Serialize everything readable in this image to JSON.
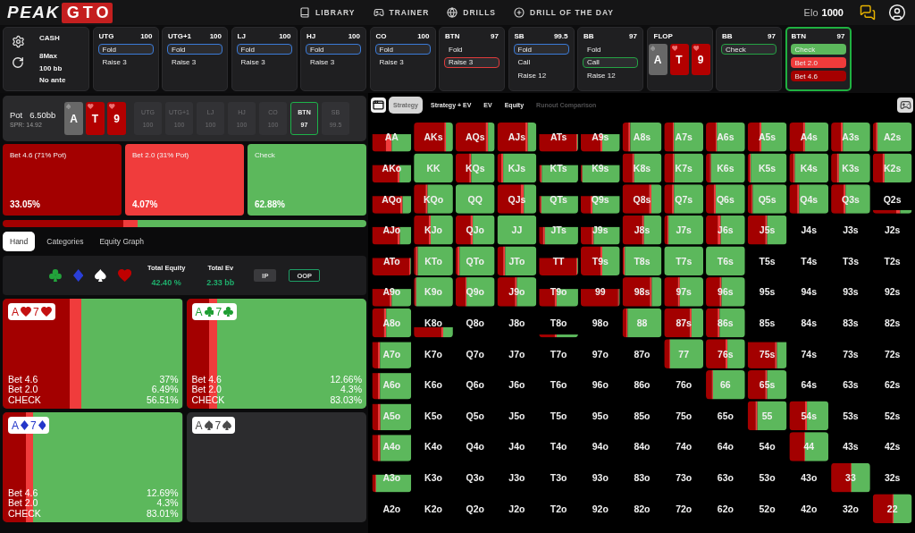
{
  "nav": {
    "logo": {
      "word": "PEAK",
      "emblem": "GTO"
    },
    "links": [
      {
        "label": "LIBRARY"
      },
      {
        "label": "TRAINER"
      },
      {
        "label": "DRILLS"
      },
      {
        "label": "DRILL OF THE DAY"
      }
    ],
    "elo": {
      "label": "Elo",
      "value": "1000"
    }
  },
  "action_history": [
    {
      "kind": "settings",
      "lines": [
        "CASH",
        "8Max",
        "100 bb",
        "No ante"
      ]
    },
    {
      "kind": "player",
      "position": "UTG",
      "stack": "100",
      "active": false,
      "options": [
        {
          "label": "Fold",
          "selected": true,
          "color": "#3b7bd8"
        },
        {
          "label": "Raise 3",
          "selected": false
        }
      ]
    },
    {
      "kind": "player",
      "position": "UTG+1",
      "stack": "100",
      "active": false,
      "options": [
        {
          "label": "Fold",
          "selected": true,
          "color": "#3b7bd8"
        },
        {
          "label": "Raise 3",
          "selected": false
        }
      ]
    },
    {
      "kind": "player",
      "position": "LJ",
      "stack": "100",
      "active": false,
      "options": [
        {
          "label": "Fold",
          "selected": true,
          "color": "#3b7bd8"
        },
        {
          "label": "Raise 3",
          "selected": false
        }
      ]
    },
    {
      "kind": "player",
      "position": "HJ",
      "stack": "100",
      "active": false,
      "options": [
        {
          "label": "Fold",
          "selected": true,
          "color": "#3b7bd8"
        },
        {
          "label": "Raise 3",
          "selected": false
        }
      ]
    },
    {
      "kind": "player",
      "position": "CO",
      "stack": "100",
      "active": false,
      "options": [
        {
          "label": "Fold",
          "selected": true,
          "color": "#3b7bd8"
        },
        {
          "label": "Raise 3",
          "selected": false
        }
      ]
    },
    {
      "kind": "player",
      "position": "BTN",
      "stack": "97",
      "active": false,
      "options": [
        {
          "label": "Fold",
          "selected": false
        },
        {
          "label": "Raise 3",
          "selected": true,
          "color": "#e03b3b"
        }
      ]
    },
    {
      "kind": "player",
      "position": "SB",
      "stack": "99.5",
      "active": false,
      "options": [
        {
          "label": "Fold",
          "selected": true,
          "color": "#3b7bd8"
        },
        {
          "label": "Call",
          "selected": false
        },
        {
          "label": "Raise 12",
          "selected": false
        }
      ]
    },
    {
      "kind": "player",
      "position": "BB",
      "stack": "97",
      "active": false,
      "options": [
        {
          "label": "Fold",
          "selected": false
        },
        {
          "label": "Call",
          "selected": true,
          "color": "#25a244"
        },
        {
          "label": "Raise 12",
          "selected": false
        }
      ]
    },
    {
      "kind": "board",
      "street": "FLOP",
      "cards": [
        {
          "rank": "A",
          "kind": "spade"
        },
        {
          "rank": "T",
          "kind": "heart"
        },
        {
          "rank": "9",
          "kind": "heart"
        }
      ]
    },
    {
      "kind": "player",
      "position": "BB",
      "stack": "97",
      "active": false,
      "options": [
        {
          "label": "Check",
          "selected": true,
          "color": "#25a244"
        }
      ]
    },
    {
      "kind": "player",
      "position": "BTN",
      "stack": "97",
      "active": true,
      "options": [
        {
          "label": "Check",
          "selected": false,
          "color": "#5cb85c"
        },
        {
          "label": "Bet 2.0",
          "selected": false,
          "color": "#ef3b3b"
        },
        {
          "label": "Bet 4.6",
          "selected": false,
          "color": "#a50000"
        }
      ]
    }
  ],
  "pot": {
    "label": "Pot",
    "value": "6.50bb",
    "spr": "SPR: 14.92",
    "board": [
      {
        "rank": "A",
        "kind": "spade"
      },
      {
        "rank": "T",
        "kind": "heart"
      },
      {
        "rank": "9",
        "kind": "heart"
      }
    ],
    "seats": [
      {
        "position": "UTG",
        "stack": "100",
        "selected": false
      },
      {
        "position": "UTG+1",
        "stack": "100",
        "selected": false
      },
      {
        "position": "LJ",
        "stack": "100",
        "selected": false
      },
      {
        "position": "HJ",
        "stack": "100",
        "selected": false
      },
      {
        "position": "CO",
        "stack": "100",
        "selected": false
      },
      {
        "position": "BTN",
        "stack": "97",
        "selected": true
      },
      {
        "position": "SB",
        "stack": "99.5",
        "selected": false
      }
    ]
  },
  "strategy": {
    "actions": [
      {
        "label": "Bet 4.6 (71% Pot)",
        "share": "33.05%",
        "color": "#a30000"
      },
      {
        "label": "Bet 2.0 (31% Pot)",
        "share": "4.07%",
        "color": "#f03c3c"
      },
      {
        "label": "Check",
        "share": "62.88%",
        "color": "#5cb85c"
      }
    ]
  },
  "hand_tabs": [
    {
      "label": "Hand",
      "selected": true
    },
    {
      "label": "Categories",
      "selected": false
    },
    {
      "label": "Equity Graph",
      "selected": false
    }
  ],
  "hand_panel": {
    "suit_filters": [
      {
        "kind": "club"
      },
      {
        "kind": "diamond"
      },
      {
        "kind": "spade"
      },
      {
        "kind": "heart"
      }
    ],
    "stats": [
      {
        "label": "Total Equity",
        "value": "42.40 %"
      },
      {
        "label": "Total Ev",
        "value": "2.33 bb"
      }
    ],
    "sides": [
      {
        "label": "IP",
        "selected": false
      },
      {
        "label": "OOP",
        "selected": true
      }
    ]
  },
  "combos": [
    {
      "cards": [
        {
          "rank": "A",
          "kind": "heart"
        },
        {
          "rank": "7",
          "kind": "heart"
        }
      ],
      "rows": [
        {
          "label": "Bet 4.6",
          "value": "37%"
        },
        {
          "label": "Bet 2.0",
          "value": "6.49%"
        },
        {
          "label": "CHECK",
          "value": "56.51%"
        }
      ]
    },
    {
      "cards": [
        {
          "rank": "A",
          "kind": "club"
        },
        {
          "rank": "7",
          "kind": "club"
        }
      ],
      "rows": [
        {
          "label": "Bet 4.6",
          "value": "12.66%"
        },
        {
          "label": "Bet 2.0",
          "value": "4.3%"
        },
        {
          "label": "CHECK",
          "value": "83.03%"
        }
      ]
    },
    {
      "cards": [
        {
          "rank": "A",
          "kind": "diamond"
        },
        {
          "rank": "7",
          "kind": "diamond"
        }
      ],
      "rows": [
        {
          "label": "Bet 4.6",
          "value": "12.69%"
        },
        {
          "label": "Bet 2.0",
          "value": "4.3%"
        },
        {
          "label": "CHECK",
          "value": "83.01%"
        }
      ]
    },
    {
      "cards": [
        {
          "rank": "A",
          "kind": "spade"
        },
        {
          "rank": "7",
          "kind": "spade"
        }
      ]
    }
  ],
  "matrix": {
    "tabs": [
      {
        "label": "Strategy",
        "selected": true,
        "disabled": false
      },
      {
        "label": "Strategy + EV",
        "selected": false,
        "disabled": false
      },
      {
        "label": "EV",
        "selected": false,
        "disabled": false
      },
      {
        "label": "Equity",
        "selected": false,
        "disabled": false
      },
      {
        "label": "Runout Comparison",
        "selected": false,
        "disabled": true
      }
    ],
    "rows": [
      {
        "cells": [
          "AA",
          "AKs",
          "AQs",
          "AJs",
          "ATs",
          "A9s",
          "A8s",
          "A7s",
          "A6s",
          "A5s",
          "A4s",
          "A3s",
          "A2s"
        ]
      },
      {
        "cells": [
          "AKo",
          "KK",
          "KQs",
          "KJs",
          "KTs",
          "K9s",
          "K8s",
          "K7s",
          "K6s",
          "K5s",
          "K4s",
          "K3s",
          "K2s"
        ]
      },
      {
        "cells": [
          "AQo",
          "KQo",
          "QQ",
          "QJs",
          "QTs",
          "Q9s",
          "Q8s",
          "Q7s",
          "Q6s",
          "Q5s",
          "Q4s",
          "Q3s",
          "Q2s"
        ]
      },
      {
        "cells": [
          "AJo",
          "KJo",
          "QJo",
          "JJ",
          "JTs",
          "J9s",
          "J8s",
          "J7s",
          "J6s",
          "J5s",
          "J4s",
          "J3s",
          "J2s"
        ]
      },
      {
        "cells": [
          "ATo",
          "KTo",
          "QTo",
          "JTo",
          "TT",
          "T9s",
          "T8s",
          "T7s",
          "T6s",
          "T5s",
          "T4s",
          "T3s",
          "T2s"
        ]
      },
      {
        "cells": [
          "A9o",
          "K9o",
          "Q9o",
          "J9o",
          "T9o",
          "99",
          "98s",
          "97s",
          "96s",
          "95s",
          "94s",
          "93s",
          "92s"
        ]
      },
      {
        "cells": [
          "A8o",
          "K8o",
          "Q8o",
          "J8o",
          "T8o",
          "98o",
          "88",
          "87s",
          "86s",
          "85s",
          "84s",
          "83s",
          "82s"
        ]
      },
      {
        "cells": [
          "A7o",
          "K7o",
          "Q7o",
          "J7o",
          "T7o",
          "97o",
          "87o",
          "77",
          "76s",
          "75s",
          "74s",
          "73s",
          "72s"
        ]
      },
      {
        "cells": [
          "A6o",
          "K6o",
          "Q6o",
          "J6o",
          "T6o",
          "96o",
          "86o",
          "76o",
          "66",
          "65s",
          "64s",
          "63s",
          "62s"
        ]
      },
      {
        "cells": [
          "A5o",
          "K5o",
          "Q5o",
          "J5o",
          "T5o",
          "95o",
          "85o",
          "75o",
          "65o",
          "55",
          "54s",
          "53s",
          "52s"
        ]
      },
      {
        "cells": [
          "A4o",
          "K4o",
          "Q4o",
          "J4o",
          "T4o",
          "94o",
          "84o",
          "74o",
          "64o",
          "54o",
          "44",
          "43s",
          "42s"
        ]
      },
      {
        "cells": [
          "A3o",
          "K3o",
          "Q3o",
          "J3o",
          "T3o",
          "93o",
          "83o",
          "73o",
          "63o",
          "53o",
          "43o",
          "33",
          "32s"
        ]
      },
      {
        "cells": [
          "A2o",
          "K2o",
          "Q2o",
          "J2o",
          "T2o",
          "92o",
          "82o",
          "72o",
          "62o",
          "52o",
          "42o",
          "32o",
          "22"
        ]
      }
    ]
  }
}
